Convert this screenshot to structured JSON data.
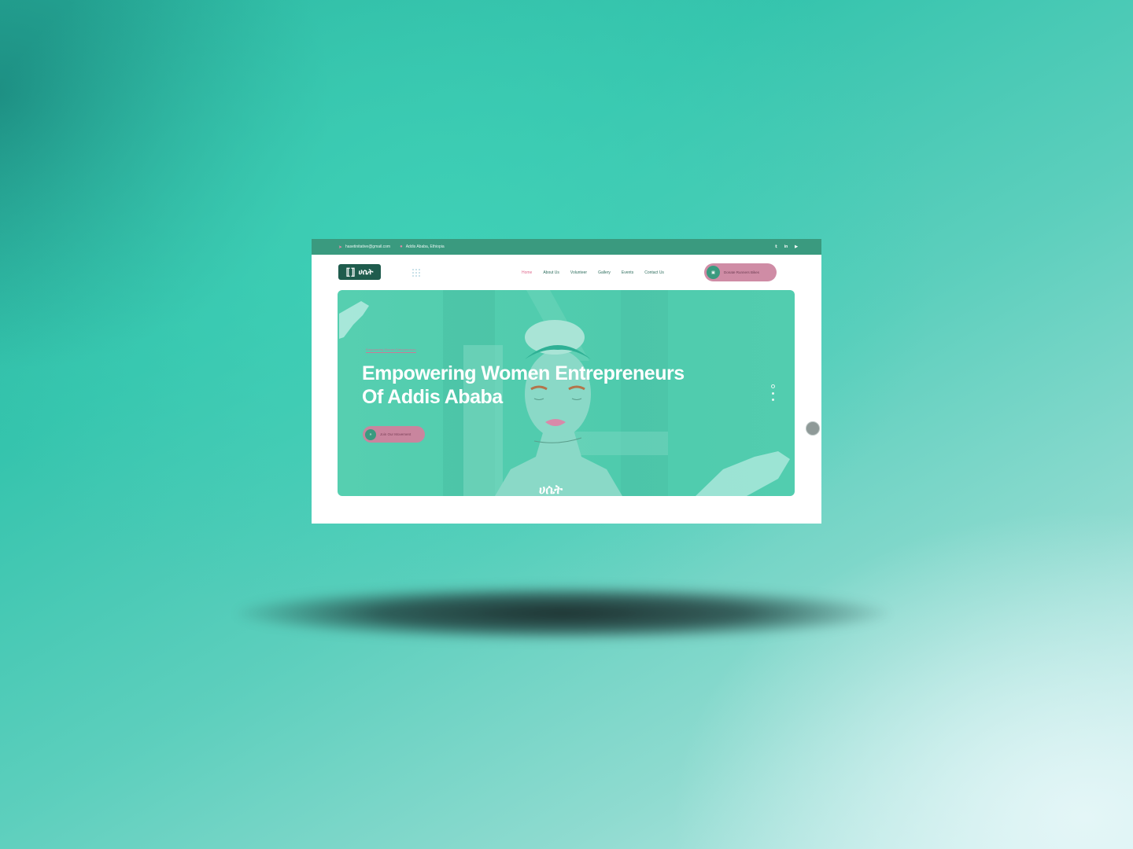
{
  "topbar": {
    "email": "hasetinitative@gmail.com",
    "address": "Addis Ababa, Ethiopia",
    "icons": [
      "send-icon",
      "location-pin-icon"
    ],
    "social": [
      "twitter-icon",
      "linkedin-icon",
      "youtube-icon"
    ]
  },
  "nav": {
    "logo_text": "ሀሴት",
    "items": [
      {
        "label": "Home",
        "active": true
      },
      {
        "label": "About Us",
        "active": false
      },
      {
        "label": "Volunteer",
        "active": false
      },
      {
        "label": "Gallery",
        "active": false
      },
      {
        "label": "Events",
        "active": false
      },
      {
        "label": "Contact Us",
        "active": false
      }
    ],
    "donate_label": "Donate Runners Bikes"
  },
  "hero": {
    "eyebrow": "Empowering Women Entrepreneurs",
    "headline_line1": "Empowering Women Entrepreneurs",
    "headline_line2": "Of Addis Ababa",
    "cta_label": "Join Our Movement",
    "watermark_text": "ሀሴት",
    "slide_count": 3,
    "active_slide": 1
  },
  "colors": {
    "accent_green": "#3a9a7f",
    "accent_pink": "#cf8ca5",
    "hero_bg": "#52cdaf"
  }
}
